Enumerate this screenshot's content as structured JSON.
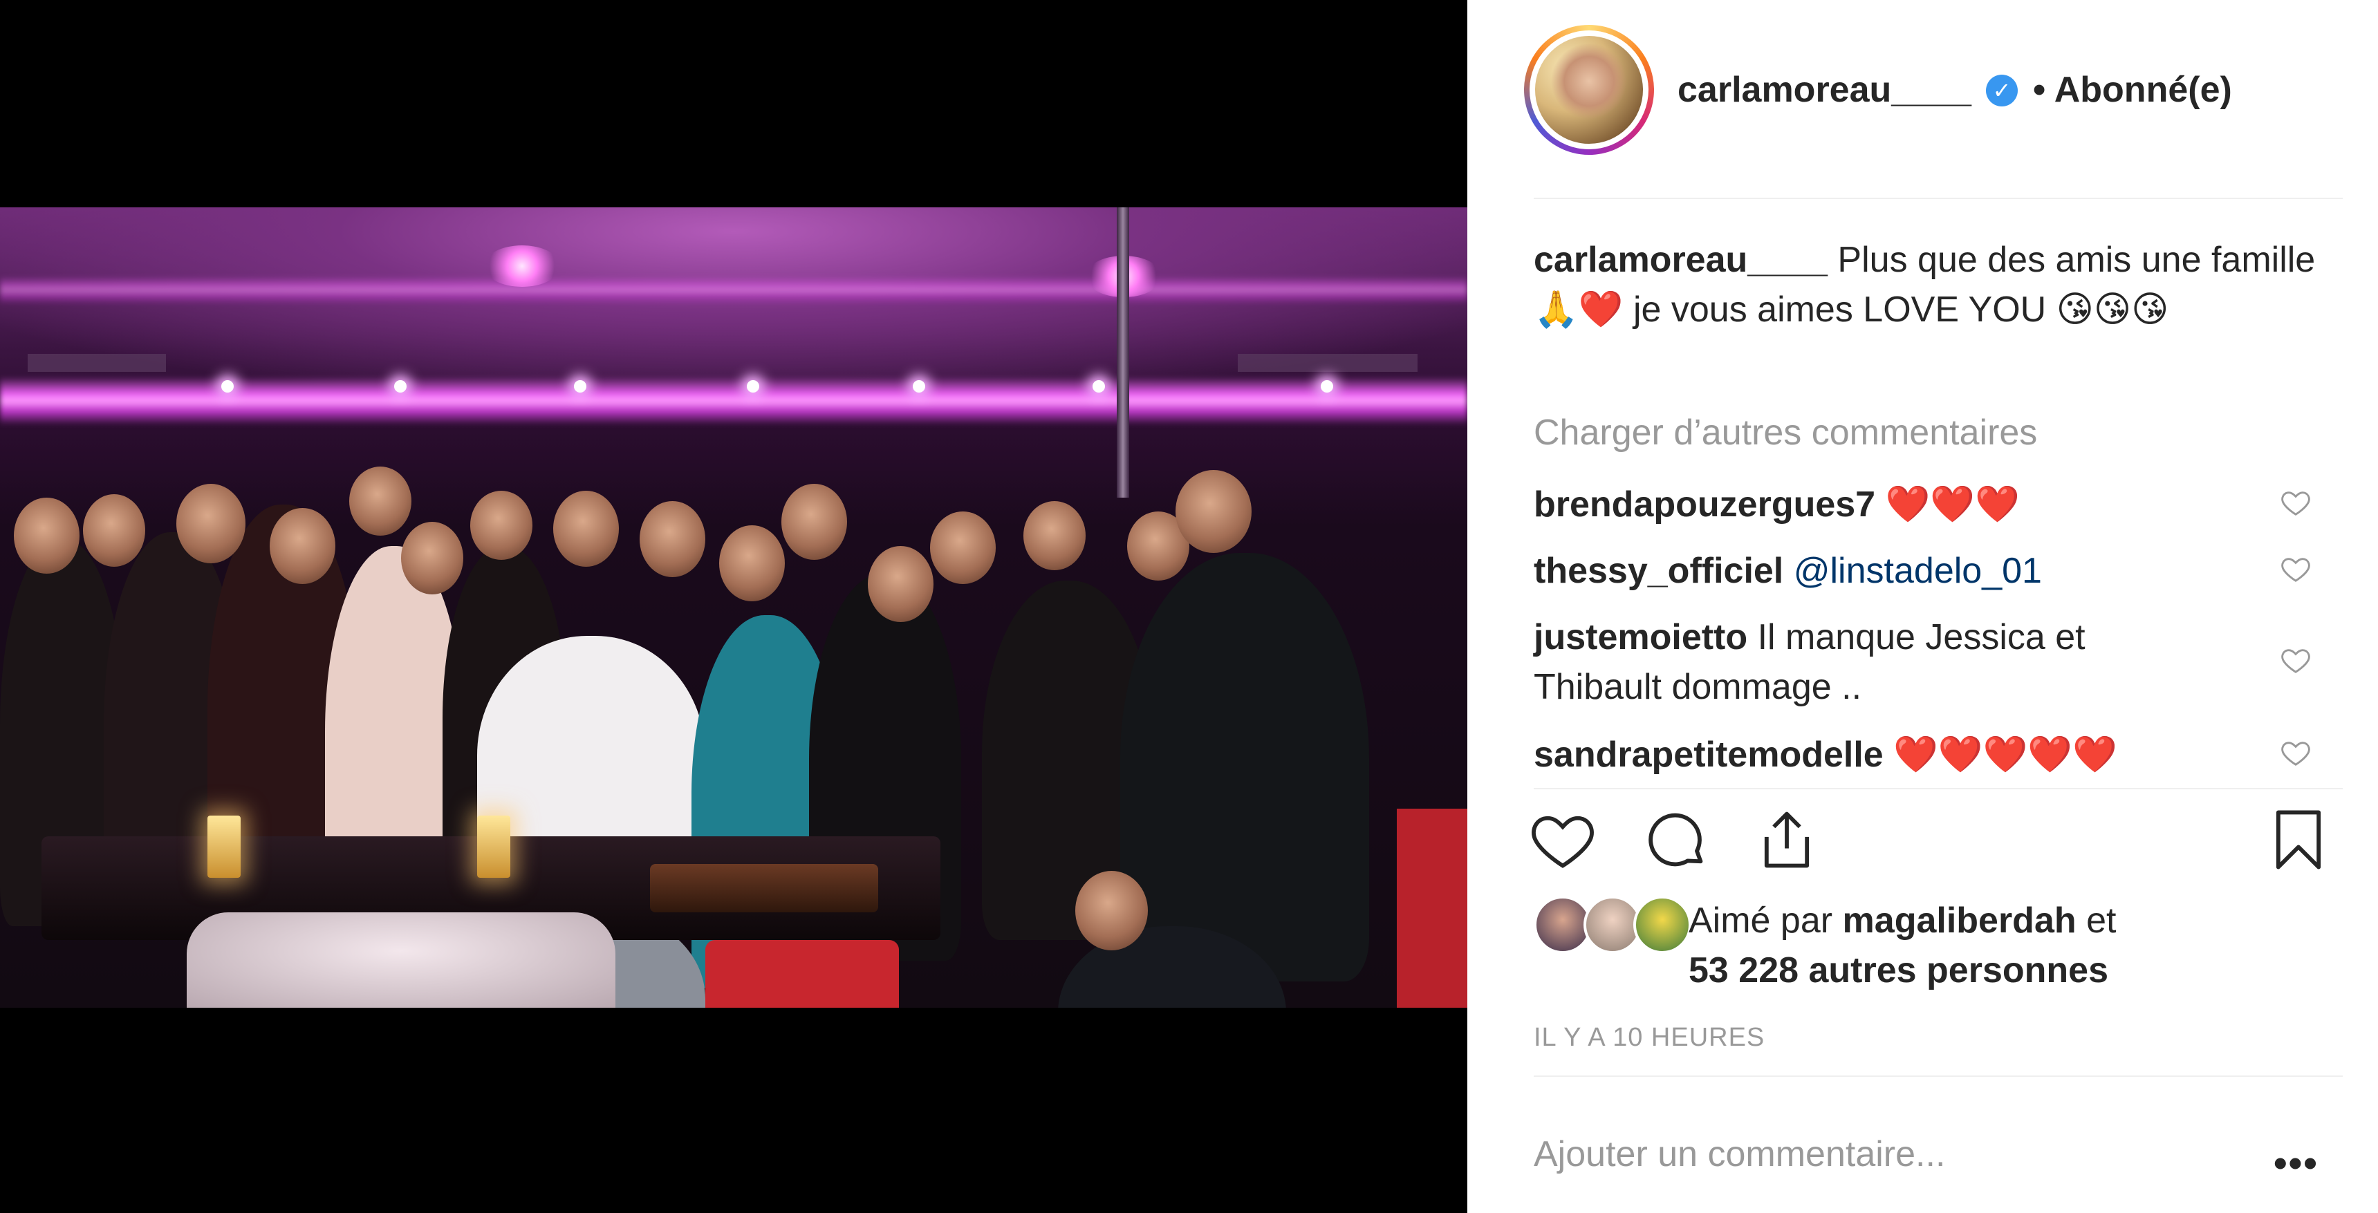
{
  "post": {
    "username": "carlamoreau____",
    "follow_status": "• Abonné(e)",
    "caption_user": "carlamoreau____",
    "caption_text": "Plus que des amis une famille 🙏❤️ je vous aimes LOVE YOU 😘😘😘",
    "load_more": "Charger d’autres commentaires",
    "comments": [
      {
        "user": "brendapouzergues7",
        "text": "❤️❤️❤️"
      },
      {
        "user": "thessy_officiel",
        "text": "@linstadelo_01"
      },
      {
        "user": "justemoietto",
        "text": "Il manque Jessica et Thibault dommage .."
      },
      {
        "user": "sandrapetitemodelle",
        "text": "❤️❤️❤️❤️❤️"
      }
    ],
    "liked_by_prefix": "Aimé par",
    "liked_by_user": "magaliberdah",
    "liked_by_suffix": "et",
    "likes_others": "53 228 autres personnes",
    "time": "IL Y A 10 HEURES",
    "add_comment_placeholder": "Ajouter un commentaire...",
    "more": "•••"
  },
  "icons": {
    "verified": "verified-badge-icon",
    "like": "heart-icon",
    "comment": "comment-bubble-icon",
    "share": "share-icon",
    "save": "bookmark-icon",
    "options": "ellipsis-icon"
  },
  "colors": {
    "verified": "#3897f0",
    "muted_text": "#999999",
    "mention": "#003569",
    "divider": "#efefef"
  }
}
